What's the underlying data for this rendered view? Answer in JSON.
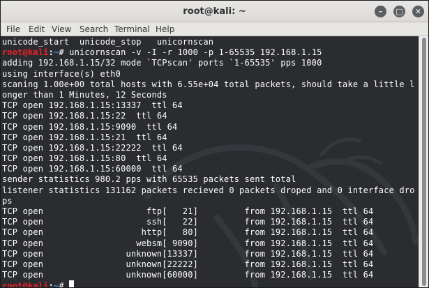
{
  "window": {
    "title": "root@kali: ~",
    "minimize_icon": "minimize-icon",
    "maximize_icon": "maximize-icon",
    "close_icon": "close-icon"
  },
  "menu": [
    "File",
    "Edit",
    "View",
    "Search",
    "Terminal",
    "Help"
  ],
  "prompt": {
    "user": "root@kali",
    "sep": ":",
    "tilde": "~",
    "symbol": "# "
  },
  "terminal": {
    "line0": "unicode_start  unicode_stop   unicornscan",
    "cmd1": "unicornscan -v -I -r 1000 -p 1-65535 192.168.1.15",
    "line2": "adding 192.168.1.15/32 mode `TCPscan' ports `1-65535' pps 1000",
    "line3": "using interface(s) eth0",
    "line4": "scaning 1.00e+00 total hosts with 6.55e+04 total packets, should take a little l",
    "line5": "onger than 1 Minutes, 12 Seconds",
    "line6": "TCP open 192.168.1.15:13337  ttl 64",
    "line7": "TCP open 192.168.1.15:22  ttl 64",
    "line8": "TCP open 192.168.1.15:9090  ttl 64",
    "line9": "TCP open 192.168.1.15:21  ttl 64",
    "line10": "TCP open 192.168.1.15:22222  ttl 64",
    "line11": "TCP open 192.168.1.15:80  ttl 64",
    "line12": "TCP open 192.168.1.15:60000  ttl 64",
    "line13": "sender statistics 980.2 pps with 65535 packets sent total",
    "line14": "listener statistics 131162 packets recieved 0 packets droped and 0 interface dro",
    "line15": "ps",
    "line16": "TCP open                    ftp[   21]         from 192.168.1.15  ttl 64",
    "line17": "TCP open                    ssh[   22]         from 192.168.1.15  ttl 64",
    "line18": "TCP open                   http[   80]         from 192.168.1.15  ttl 64",
    "line19": "TCP open                  websm[ 9090]         from 192.168.1.15  ttl 64",
    "line20": "TCP open                unknown[13337]         from 192.168.1.15  ttl 64",
    "line21": "TCP open                unknown[22222]         from 192.168.1.15  ttl 64",
    "line22": "TCP open                unknown[60000]         from 192.168.1.15  ttl 64"
  },
  "watermark_icon": "kali-dragon-icon",
  "colors": {
    "terminal_bg": "#2a2c30",
    "prompt_user": "#f0202a",
    "prompt_path": "#4b8fe0"
  }
}
